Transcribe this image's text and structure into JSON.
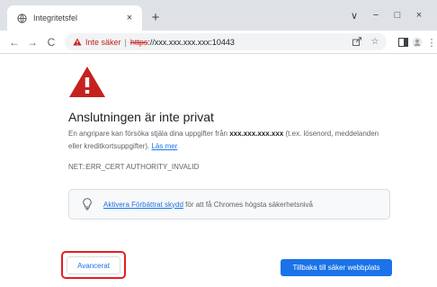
{
  "tab": {
    "title": "Integritetsfel",
    "close_glyph": "×",
    "favicon": "globe-icon",
    "new_tab_glyph": "+"
  },
  "window_controls": {
    "tab_search": "∨",
    "minimize": "−",
    "maximize": "□",
    "close": "×"
  },
  "toolbar": {
    "back": "←",
    "forward": "→",
    "reload": "C",
    "not_secure_label": "Inte säker",
    "separator": "|",
    "url_scheme": "https",
    "url_rest": "://xxx.xxx.xxx.xxx:10443",
    "share_icon": "share-icon",
    "bookmark_glyph": "☆",
    "sidepanel_icon": "side-panel-icon",
    "profile_icon": "profile-icon",
    "menu_glyph": "⋮"
  },
  "page": {
    "heading": "Anslutningen är inte privat",
    "desc_part1": "En angripare kan försöka stjäla dina uppgifter från ",
    "desc_host": "xxx.xxx.xxx.xxx",
    "desc_part2": " (t.ex. lösenord, meddelanden eller kreditkortsuppgifter). ",
    "learn_more": "Läs mer",
    "error_code": "NET::ERR_CERT AUTHORITY_INVALID",
    "protect_link": "Aktivera Förbättrat skydd",
    "protect_text": " för att få Chromes högsta säkerhetsnivå",
    "advanced_button": "Avancerat",
    "back_button": "Tillbaka till säker webbplats"
  },
  "colors": {
    "warning_red": "#c5221f",
    "highlight_red": "#e31e24",
    "link_blue": "#1a73e8",
    "primary_button": "#1a73e8"
  }
}
